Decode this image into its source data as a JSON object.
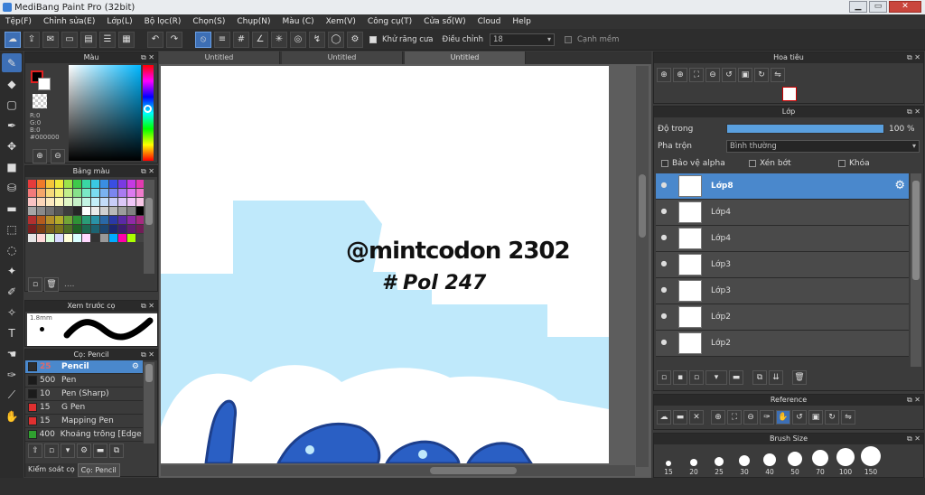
{
  "app": {
    "title": "MediBang Paint Pro (32bit)",
    "win_min": "▁",
    "win_max": "▭",
    "win_close": "✕"
  },
  "menu": [
    "Tệp(F)",
    "Chỉnh sửa(E)",
    "Lớp(L)",
    "Bộ lọc(R)",
    "Chọn(S)",
    "Chụp(N)",
    "Màu (C)",
    "Xem(V)",
    "Công cụ(T)",
    "Cửa sổ(W)",
    "Cloud",
    "Help"
  ],
  "toolbar": {
    "antialias": "Khử răng cưa",
    "adjust": "Điều chỉnh",
    "adjust_value": "18",
    "edge": "Cạnh mềm"
  },
  "color_panel": {
    "title": "Màu",
    "r": "R:0",
    "g": "G:0",
    "b": "B:0",
    "hex": "#000000"
  },
  "palette_panel": {
    "title": "Bảng màu",
    "footer": "...."
  },
  "preview_panel": {
    "title": "Xem trước cọ",
    "size": "1.8mm"
  },
  "brush_panel": {
    "title": "Cọ: Pencil",
    "items": [
      {
        "size": "25",
        "name": "Pencil",
        "color": "#2d2d2d"
      },
      {
        "size": "500",
        "name": "Pen",
        "color": "#1b1b1b"
      },
      {
        "size": "10",
        "name": "Pen (Sharp)",
        "color": "#1b1b1b"
      },
      {
        "size": "15",
        "name": "G Pen",
        "color": "#e03030"
      },
      {
        "size": "15",
        "name": "Mapping Pen",
        "color": "#e03030"
      },
      {
        "size": "400",
        "name": "Khoảng trống [Edge I",
        "color": "#2fa02f"
      }
    ],
    "tab1": "Kiểm soát cọ",
    "tab2": "Cọ: Pencil"
  },
  "canvas": {
    "tabs": [
      "Untitled",
      "Untitled",
      "Untitled"
    ],
    "text1": "@mintcodon 2302",
    "text2": "# Pol 247"
  },
  "navigator": {
    "title": "Hoa tiêu"
  },
  "layer_panel": {
    "title": "Lớp",
    "opacity_label": "Độ trong",
    "opacity_value": "100 %",
    "blend_label": "Pha trộn",
    "blend_value": "Bình thường",
    "protect": "Bảo vệ alpha",
    "clip": "Xén bớt",
    "lock": "Khóa",
    "layers": [
      "Lớp8",
      "Lớp4",
      "Lớp4",
      "Lớp3",
      "Lớp3",
      "Lớp2",
      "Lớp2"
    ]
  },
  "reference": {
    "title": "Reference"
  },
  "brush_size": {
    "title": "Brush Size",
    "sizes": [
      "15",
      "20",
      "25",
      "30",
      "40",
      "50",
      "70",
      "100",
      "150"
    ]
  },
  "colors": {
    "accent": "#3d6fb5",
    "selected_row": "#4a88cc",
    "sky": "#bfe9fb",
    "ink": "#2a5fc4"
  }
}
